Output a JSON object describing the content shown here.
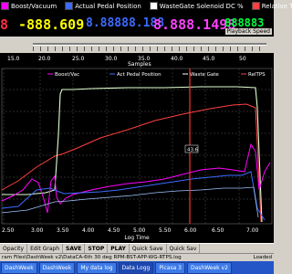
{
  "legend": [
    {
      "label": "Boost/Vacuum",
      "color": "#ff00ff"
    },
    {
      "label": "Actual Pedal Position",
      "color": "#3d6bff"
    },
    {
      "label": "WasteGate Solenoid DC %",
      "color": "#ffffff"
    },
    {
      "label": "Relative TPS",
      "color": "#ff4040"
    }
  ],
  "digits": [
    {
      "text": "8",
      "color": "#ff3040"
    },
    {
      "text": "-888.609",
      "color": "#ffff00"
    },
    {
      "text": "8.88888.188",
      "color": "#3d6bff"
    },
    {
      "text": "8.888.1498",
      "color": "#ff40ff"
    },
    {
      "text": "888883",
      "color": "#00ff40"
    }
  ],
  "playback_label": "Playback Speed",
  "chart": {
    "top_ticks": [
      "15.0",
      "20.0",
      "25.0",
      "30.0",
      "35.0",
      "40.0",
      "45.0",
      "50"
    ],
    "top_axis_label": "Samples",
    "series_labels": [
      "Boost/Vac",
      "Act Pedal Position",
      "Waste Gate",
      "RelTPS"
    ],
    "cursor_value": "43.6",
    "x_ticks": [
      "2.50",
      "3.00",
      "3.50",
      "4.00",
      "4.50",
      "5.00",
      "5.50",
      "6.00",
      "6.50",
      "7.00"
    ],
    "x_axis_label": "Log Time"
  },
  "toolbar": [
    {
      "label": "Opacity",
      "bold": false
    },
    {
      "label": "Edit Graph",
      "bold": false
    },
    {
      "label": "SAVE",
      "bold": true
    },
    {
      "label": "STOP",
      "bold": true
    },
    {
      "label": "PLAY",
      "bold": true
    },
    {
      "label": "Quick Save",
      "bold": false
    },
    {
      "label": "Quick Sav",
      "bold": false
    }
  ],
  "status_path": "ram Files\\DashWeek v2\\DataCA-6th 30 deg RPM-BST-APP-WG-RTPS.log",
  "status_right": "Loaded",
  "taskbar": [
    {
      "label": "DashWeek",
      "active": false
    },
    {
      "label": "DashWeek",
      "active": false
    },
    {
      "label": "My data log",
      "active": false
    },
    {
      "label": "Data Logg",
      "active": true
    },
    {
      "label": "Picasa 3",
      "active": false
    },
    {
      "label": "DashWeek v2",
      "active": false
    }
  ]
}
